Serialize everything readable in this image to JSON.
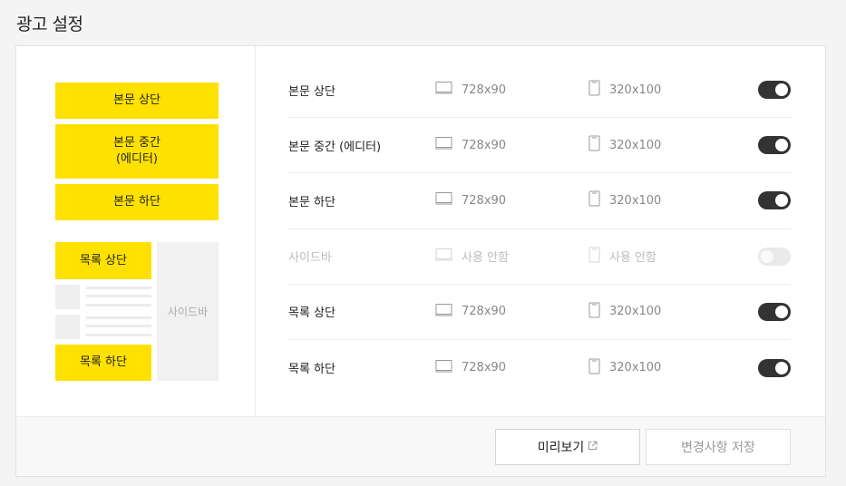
{
  "page": {
    "title": "광고 설정"
  },
  "preview": {
    "top": "본문 상단",
    "middle_line1": "본문 중간",
    "middle_line2": "(에디터)",
    "bottom": "본문 하단",
    "list_top": "목록 상단",
    "list_bottom": "목록 하단",
    "sidebar": "사이드바"
  },
  "settings": [
    {
      "label": "본문 상단",
      "pc": "728x90",
      "mobile": "320x100",
      "enabled": true
    },
    {
      "label": "본문 중간 (에디터)",
      "pc": "728x90",
      "mobile": "320x100",
      "enabled": true
    },
    {
      "label": "본문 하단",
      "pc": "728x90",
      "mobile": "320x100",
      "enabled": true
    },
    {
      "label": "사이드바",
      "pc": "사용 안함",
      "mobile": "사용 안함",
      "enabled": false
    },
    {
      "label": "목록 상단",
      "pc": "728x90",
      "mobile": "320x100",
      "enabled": true
    },
    {
      "label": "목록 하단",
      "pc": "728x90",
      "mobile": "320x100",
      "enabled": true
    }
  ],
  "footer": {
    "preview_label": "미리보기",
    "save_label": "변경사항 저장"
  },
  "icons": {
    "pc": "monitor-icon",
    "mobile": "phone-icon",
    "external": "external-link-icon"
  },
  "colors": {
    "accent": "#ffe100",
    "toggle_on": "#333333",
    "toggle_off": "#e9e9e9"
  }
}
